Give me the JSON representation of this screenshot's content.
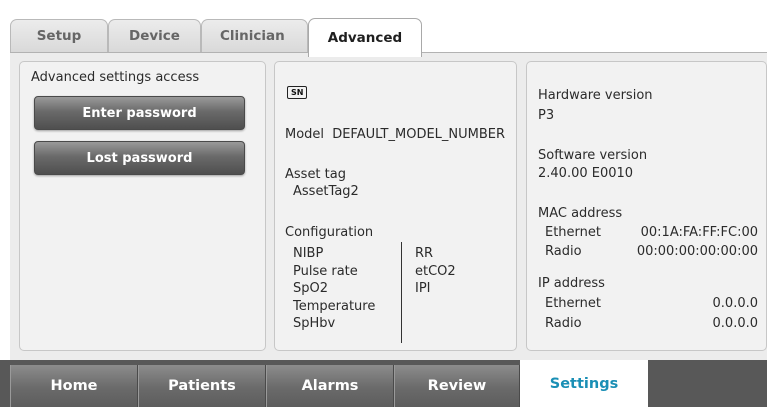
{
  "top_tabs": [
    {
      "label": "Setup"
    },
    {
      "label": "Device"
    },
    {
      "label": "Clinician"
    },
    {
      "label": "Advanced",
      "active": true
    }
  ],
  "left_panel": {
    "heading": "Advanced settings access",
    "enter_password_label": "Enter password",
    "lost_password_label": "Lost password"
  },
  "middle_panel": {
    "sn_badge": "SN",
    "model_label": "Model",
    "model_value": "DEFAULT_MODEL_NUMBER",
    "asset_tag_label": "Asset tag",
    "asset_tag_value": "AssetTag2",
    "configuration_label": "Configuration",
    "config_col1": [
      "NIBP",
      "Pulse rate",
      "SpO2",
      "Temperature",
      "SpHbv"
    ],
    "config_col2": [
      "RR",
      "etCO2",
      "IPI"
    ]
  },
  "right_panel": {
    "hardware_version_label": "Hardware version",
    "hardware_version_value": "P3",
    "software_version_label": "Software version",
    "software_version_value": "2.40.00 E0010",
    "mac_address_label": "MAC address",
    "mac_ethernet_label": "Ethernet",
    "mac_ethernet_value": "00:1A:FA:FF:FC:00",
    "mac_radio_label": "Radio",
    "mac_radio_value": "00:00:00:00:00:00",
    "ip_address_label": "IP address",
    "ip_ethernet_label": "Ethernet",
    "ip_ethernet_value": "0.0.0.0",
    "ip_radio_label": "Radio",
    "ip_radio_value": "0.0.0.0"
  },
  "bottom_nav": [
    {
      "label": "Home"
    },
    {
      "label": "Patients"
    },
    {
      "label": "Alarms"
    },
    {
      "label": "Review"
    },
    {
      "label": "Settings",
      "active": true
    }
  ],
  "colors": {
    "active_nav_text": "#1a8fb5",
    "nav_background": "#585858",
    "button_dark": "#555555",
    "panel_background": "#f2f2f2"
  }
}
